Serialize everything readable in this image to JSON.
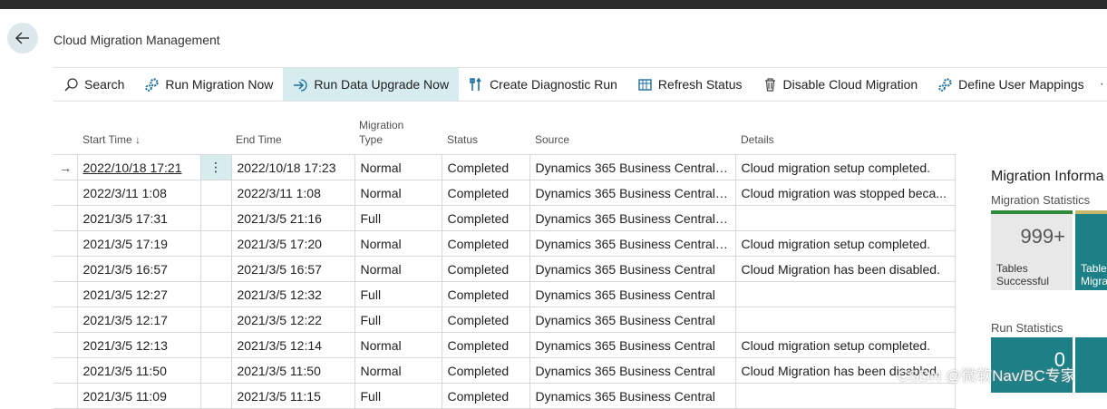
{
  "page": {
    "title": "Cloud Migration Management"
  },
  "actions": [
    {
      "label": "Search",
      "icon": "search-icon"
    },
    {
      "label": "Run Migration Now",
      "icon": "gears-icon"
    },
    {
      "label": "Run Data Upgrade Now",
      "icon": "enter-arrow-icon"
    },
    {
      "label": "Create Diagnostic Run",
      "icon": "tools-icon"
    },
    {
      "label": "Refresh Status",
      "icon": "refresh-icon"
    },
    {
      "label": "Disable Cloud Migration",
      "icon": "trash-icon"
    },
    {
      "label": "Define User Mappings",
      "icon": "gears-icon"
    }
  ],
  "more_label": "···",
  "columns": {
    "start_time": "Start Time ↓",
    "end_time": "End Time",
    "migration_type_line1": "Migration",
    "migration_type_line2": "Type",
    "status": "Status",
    "source": "Source",
    "details": "Details"
  },
  "rows": [
    {
      "start": "2022/10/18 17:21",
      "end": "2022/10/18 17:23",
      "type": "Normal",
      "status": "Completed",
      "source": "Dynamics 365 Business Central c...",
      "details": "Cloud migration setup completed."
    },
    {
      "start": "2022/3/11 1:08",
      "end": "2022/3/11 1:08",
      "type": "Normal",
      "status": "Completed",
      "source": "Dynamics 365 Business Central c...",
      "details": "Cloud migration was stopped beca..."
    },
    {
      "start": "2021/3/5 17:31",
      "end": "2021/3/5 21:16",
      "type": "Full",
      "status": "Completed",
      "source": "Dynamics 365 Business Central (P...",
      "details": ""
    },
    {
      "start": "2021/3/5 17:19",
      "end": "2021/3/5 17:20",
      "type": "Normal",
      "status": "Completed",
      "source": "Dynamics 365 Business Central (P...",
      "details": "Cloud migration setup completed."
    },
    {
      "start": "2021/3/5 16:57",
      "end": "2021/3/5 16:57",
      "type": "Normal",
      "status": "Completed",
      "source": "Dynamics 365 Business Central",
      "details": "Cloud Migration has been disabled."
    },
    {
      "start": "2021/3/5 12:27",
      "end": "2021/3/5 12:32",
      "type": "Full",
      "status": "Completed",
      "source": "Dynamics 365 Business Central",
      "details": ""
    },
    {
      "start": "2021/3/5 12:17",
      "end": "2021/3/5 12:22",
      "type": "Full",
      "status": "Completed",
      "source": "Dynamics 365 Business Central",
      "details": ""
    },
    {
      "start": "2021/3/5 12:13",
      "end": "2021/3/5 12:14",
      "type": "Normal",
      "status": "Completed",
      "source": "Dynamics 365 Business Central",
      "details": "Cloud migration setup completed."
    },
    {
      "start": "2021/3/5 11:50",
      "end": "2021/3/5 11:50",
      "type": "Normal",
      "status": "Completed",
      "source": "Dynamics 365 Business Central",
      "details": "Cloud Migration has been disabled."
    },
    {
      "start": "2021/3/5 11:09",
      "end": "2021/3/5 11:15",
      "type": "Full",
      "status": "Completed",
      "source": "Dynamics 365 Business Central",
      "details": ""
    }
  ],
  "panel": {
    "title": "Migration Informa",
    "migration_statistics": "Migration Statistics",
    "tile1": {
      "value": "999+",
      "label_line1": "Tables",
      "label_line2": "Successful",
      "accent": "#2e8b3c",
      "bg": "#e8e8e8"
    },
    "tile2": {
      "label_line1": "Table",
      "label_line2": "Migra",
      "accent": "#c8b86a",
      "bg": "#1e8087"
    },
    "run_statistics": "Run Statistics",
    "tile3": {
      "value": "0",
      "bg": "#1e8087"
    },
    "tile4": {
      "bg": "#1e8087"
    }
  },
  "watermark": "CSDN @微软Nav/BC专家",
  "colors": {
    "selected_bg": "#d6ecef",
    "teal": "#1e8087"
  }
}
